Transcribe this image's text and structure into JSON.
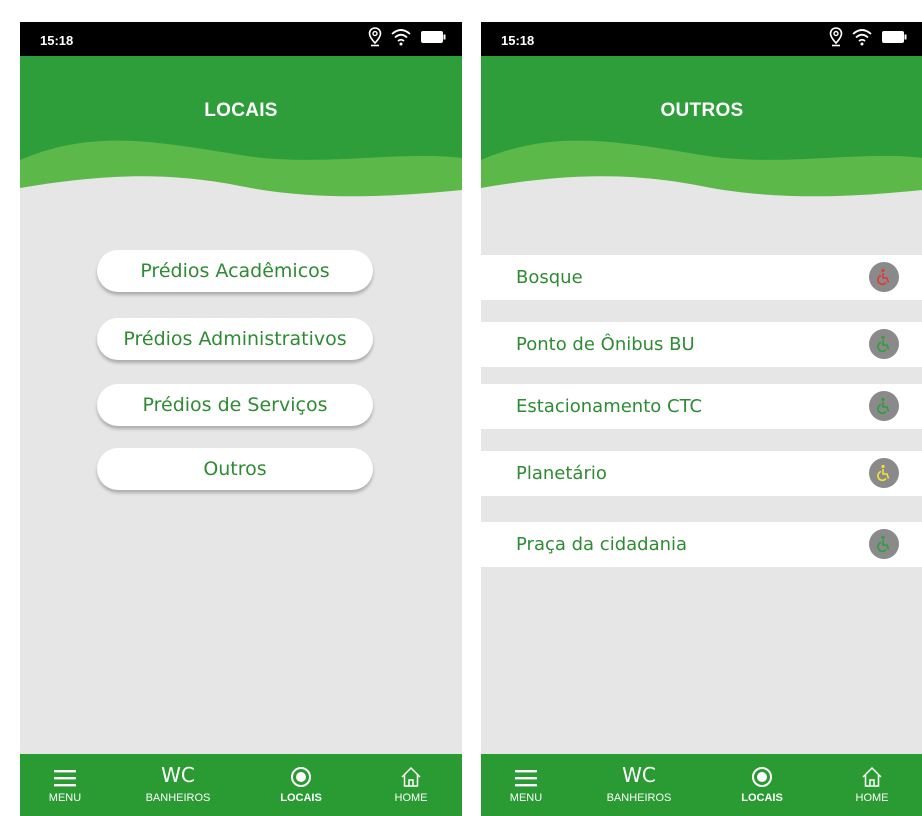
{
  "left": {
    "status": {
      "time": "15:18"
    },
    "header": {
      "title": "LOCAIS"
    },
    "menu": [
      {
        "label": "Prédios Acadêmicos"
      },
      {
        "label": "Prédios Administrativos"
      },
      {
        "label": "Prédios de Serviços"
      },
      {
        "label": "Outros"
      }
    ]
  },
  "right": {
    "status": {
      "time": "15:18"
    },
    "header": {
      "title": "OUTROS"
    },
    "items": [
      {
        "label": "Bosque",
        "access_color": "#e53935"
      },
      {
        "label": "Ponto de Ônibus BU",
        "access_color": "#2e9e3a"
      },
      {
        "label": "Estacionamento CTC",
        "access_color": "#2e9e3a"
      },
      {
        "label": "Planetário",
        "access_color": "#f2e23a"
      },
      {
        "label": "Praça da cidadania",
        "access_color": "#2e9e3a"
      }
    ]
  },
  "tabbar": {
    "menu": "MENU",
    "wc_icon": "WC",
    "banheiros": "BANHEIROS",
    "locais": "LOCAIS",
    "home": "HOME"
  },
  "colors": {
    "brand_green": "#2e9e3a",
    "wave_light_green": "#5db84a",
    "text_green": "#2e8b34",
    "background": "#e6e6e6"
  },
  "icons": [
    "location-pin-icon",
    "wifi-icon",
    "battery-icon",
    "hamburger-icon",
    "target-icon",
    "home-icon",
    "wheelchair-icon"
  ]
}
